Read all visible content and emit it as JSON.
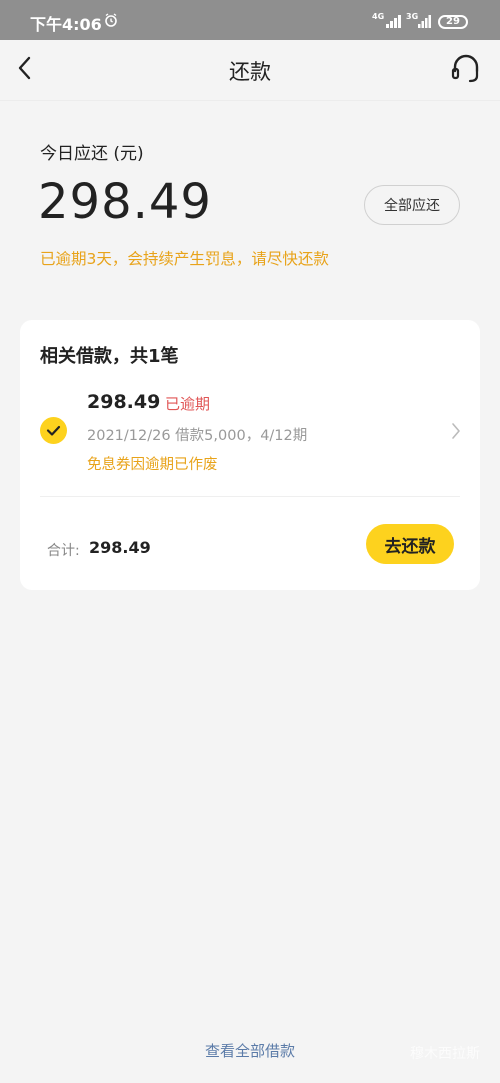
{
  "status_bar": {
    "time": "下午4:06",
    "network_1": "4G",
    "network_2": "3G",
    "battery": "29"
  },
  "nav": {
    "title": "还款"
  },
  "summary": {
    "today_label": "今日应还 (元)",
    "today_amount": "298.49",
    "all_due_label": "全部应还",
    "warning": "已逾期3天，会持续产生罚息，请尽快还款"
  },
  "loan_card": {
    "title": "相关借款，共1笔",
    "loan": {
      "amount": "298.49",
      "status": "已逾期",
      "detail": "2021/12/26 借款5,000，4/12期",
      "note": "免息券因逾期已作废"
    },
    "total_label": "合计:",
    "total_value": "298.49",
    "repay_label": "去还款"
  },
  "footer": {
    "view_all_label": "查看全部借款",
    "watermark": "穆木西拉斯"
  },
  "colors": {
    "accent_yellow": "#fdd21e",
    "warning_orange": "#e8a31a",
    "overdue_red": "#e05555",
    "link_blue": "#5b7ba8"
  },
  "icons": [
    "alarm-icon",
    "back-icon",
    "headset-icon",
    "check-icon",
    "chevron-right-icon"
  ]
}
